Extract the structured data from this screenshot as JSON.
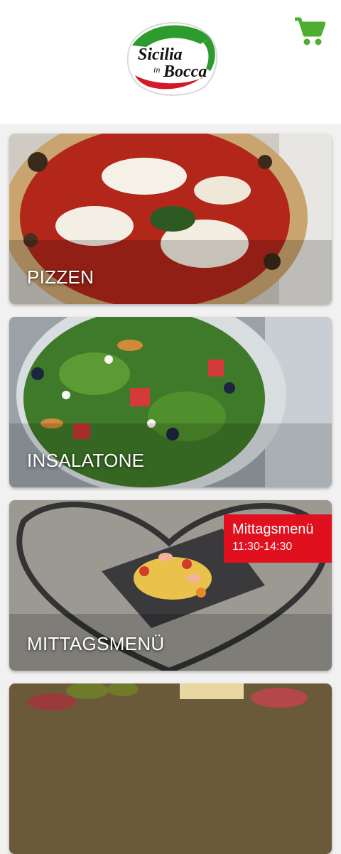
{
  "header": {
    "logo_line1": "Sicilia",
    "logo_in": "in",
    "logo_line2": "Bocca",
    "cart_icon": "shopping-cart-icon",
    "accent_color": "#4caf2f"
  },
  "categories": [
    {
      "label": "PIZZEN"
    },
    {
      "label": "INSALATONE"
    },
    {
      "label": "MITTAGSMENÜ",
      "badge": {
        "title": "Mittagsmenü",
        "time": "11:30-14:30"
      }
    },
    {
      "label": ""
    }
  ],
  "colors": {
    "badge": "#e0101f",
    "background": "#f1f1f1"
  }
}
